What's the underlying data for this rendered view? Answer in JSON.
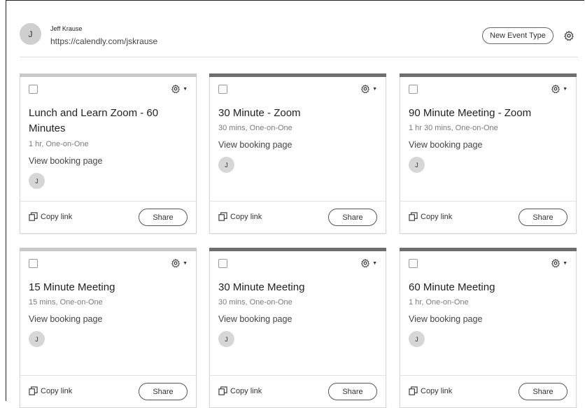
{
  "header": {
    "avatar_initial": "J",
    "user_name": "Jeff Krause",
    "user_url": "https://calendly.com/jskrause",
    "new_event_label": "New Event Type"
  },
  "cards": [
    {
      "title": "Lunch and Learn Zoom - 60 Minutes",
      "meta": "1 hr, One-on-One",
      "view_label": "View booking page",
      "avatar_initial": "J",
      "copy_label": "Copy link",
      "share_label": "Share",
      "bar_color": "#c9c9c9"
    },
    {
      "title": "30 Minute - Zoom",
      "meta": "30 mins, One-on-One",
      "view_label": "View booking page",
      "avatar_initial": "J",
      "copy_label": "Copy link",
      "share_label": "Share",
      "bar_color": "#6e6e6e"
    },
    {
      "title": "90 Minute Meeting - Zoom",
      "meta": "1 hr 30 mins, One-on-One",
      "view_label": "View booking page",
      "avatar_initial": "J",
      "copy_label": "Copy link",
      "share_label": "Share",
      "bar_color": "#6e6e6e"
    },
    {
      "title": "15 Minute Meeting",
      "meta": "15 mins, One-on-One",
      "view_label": "View booking page",
      "avatar_initial": "J",
      "copy_label": "Copy link",
      "share_label": "Share",
      "bar_color": "#c9c9c9"
    },
    {
      "title": "30 Minute Meeting",
      "meta": "30 mins, One-on-One",
      "view_label": "View booking page",
      "avatar_initial": "J",
      "copy_label": "Copy link",
      "share_label": "Share",
      "bar_color": "#6e6e6e"
    },
    {
      "title": "60 Minute Meeting",
      "meta": "1 hr, One-on-One",
      "view_label": "View booking page",
      "avatar_initial": "J",
      "copy_label": "Copy link",
      "share_label": "Share",
      "bar_color": "#6e6e6e"
    }
  ]
}
